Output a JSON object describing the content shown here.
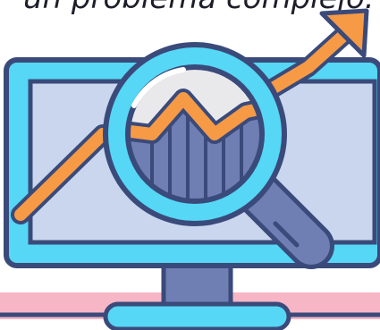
{
  "caption": {
    "text": "un problema complejo."
  },
  "illustration": {
    "icon": "data-analysis-monitor-icon",
    "magnifier_icon": "magnifying-glass-icon",
    "trend_icon": "trend-up-arrow-icon"
  },
  "colors": {
    "outline": "#3a4a7a",
    "monitor_frame": "#55d7f5",
    "screen": "#c9d6ee",
    "trend_line": "#f79a45",
    "lens_background": "#e9e9ec",
    "bar_fill": "#6f7fb3",
    "handle": "#6f7fb3",
    "floor_stripe": "#f6b6c6"
  }
}
